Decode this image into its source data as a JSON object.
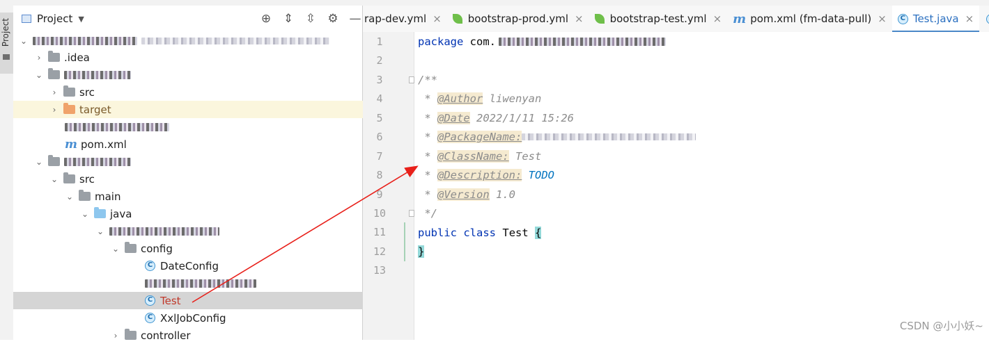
{
  "project_panel": {
    "title": "Project",
    "side_tab_label": "Project"
  },
  "tree": {
    "idea": ".idea",
    "src1": "src",
    "target": "target",
    "pom": "pom.xml",
    "src2": "src",
    "main": "main",
    "java": "java",
    "config": "config",
    "dateconfig": "DateConfig",
    "test": "Test",
    "xxljob": "XxlJobConfig",
    "controller": "controller"
  },
  "tabs": {
    "tab1": "rap-dev.yml",
    "tab2": "bootstrap-prod.yml",
    "tab3": "bootstrap-test.yml",
    "tab4": "pom.xml (fm-data-pull)",
    "tab5": "Test.java"
  },
  "code": {
    "line_numbers": [
      "1",
      "2",
      "3",
      "4",
      "5",
      "6",
      "7",
      "8",
      "9",
      "10",
      "11",
      "12",
      "13"
    ],
    "l1_kw": "package",
    "l1_pkg": "com.",
    "l3": "/**",
    "l4_tag": "@Author",
    "l4_val": " liwenyan",
    "l5_tag": "@Date",
    "l5_val": " 2022/1/11 15:26",
    "l6_tag": "@PackageName:",
    "l7_tag": "@ClassName:",
    "l7_val": " Test",
    "l8_tag": "@Description:",
    "l8_val": "TODO",
    "l9_tag": "@Version",
    "l9_val": " 1.0",
    "l10": " */",
    "l11_kw1": "public",
    "l11_kw2": "class",
    "l11_name": "Test",
    "l11_brace": "{",
    "l12_brace": "}",
    "comment_star": " * "
  },
  "watermark": "CSDN @小小妖~",
  "colors": {
    "keyword": "#0033b3",
    "comment": "#8c8c8c",
    "todo": "#0073bf",
    "annotation_arrow": "#e8201a"
  }
}
